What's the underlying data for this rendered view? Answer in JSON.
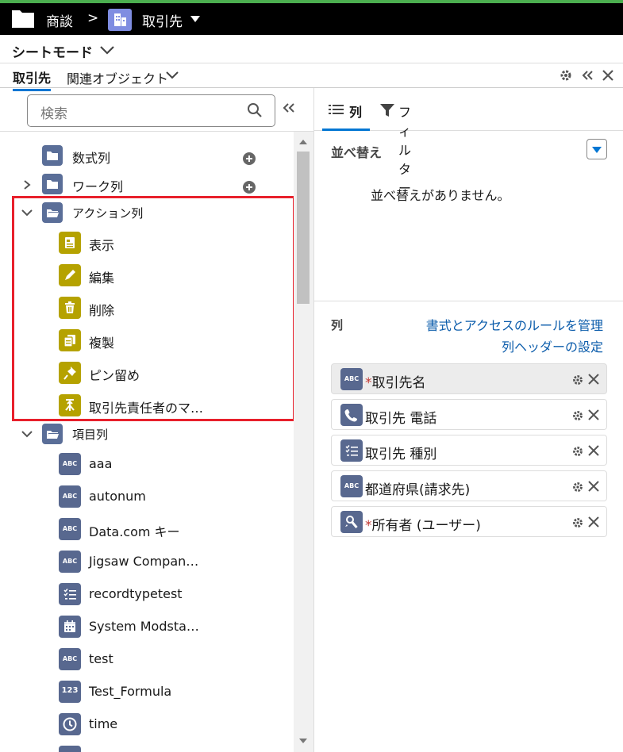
{
  "topbar": {
    "breadcrumb": "商談",
    "separator": ">",
    "object": "取引先"
  },
  "mode": {
    "label": "シートモード"
  },
  "tabs": {
    "primary": "取引先",
    "secondary": "関連オブジェクト"
  },
  "search": {
    "placeholder": "検索"
  },
  "tree": {
    "formula": "数式列",
    "work": "ワーク列",
    "action": "アクション列",
    "actions": [
      "表示",
      "編集",
      "削除",
      "複製",
      "ピン留め",
      "取引先責任者のマ…"
    ],
    "fields_group": "項目列",
    "fields": [
      "aaa",
      "autonum",
      "Data.com キー",
      "Jigsaw Compan…",
      "recordtypetest",
      "System Modsta…",
      "test",
      "Test_Formula",
      "time"
    ],
    "abc": "ABC",
    "n123": "123"
  },
  "right": {
    "tab_columns": "列",
    "tab_filter": "フィルター",
    "sort_heading": "並べ替え",
    "no_sort": "並べ替えがありません。",
    "columns_heading": "列",
    "link_manage": "書式とアクセスのルールを管理",
    "link_header": "列ヘッダーの設定",
    "required_mark": "*",
    "columns": [
      "取引先名",
      "取引先 電話",
      "取引先 種別",
      "都道府県(請求先)",
      "所有者 (ユーザー)"
    ]
  }
}
